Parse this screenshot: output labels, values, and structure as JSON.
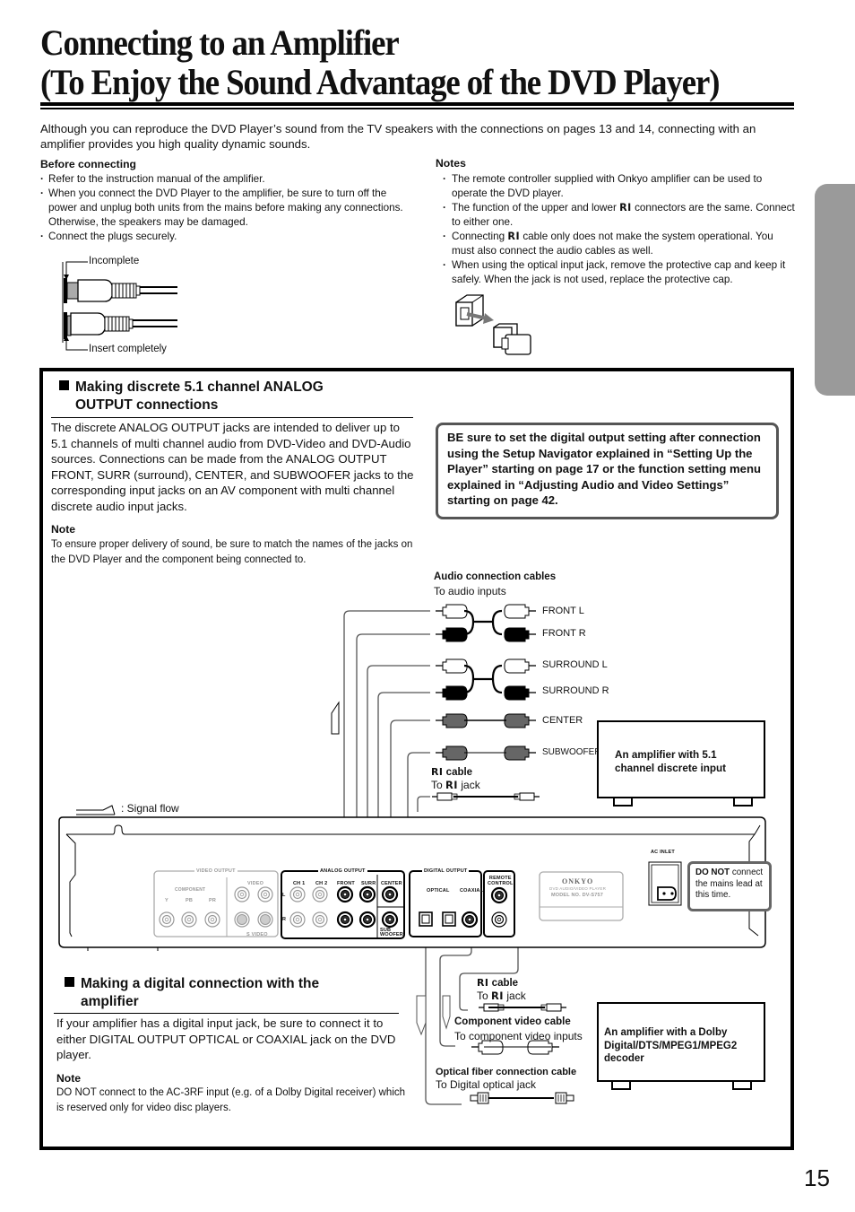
{
  "page": {
    "title_line1": "Connecting to an Amplifier",
    "title_line2": "(To Enjoy the Sound Advantage of the DVD Player)",
    "intro": "Although you can reproduce the DVD Player’s sound from the TV speakers with the connections on pages 13 and 14, connecting with an amplifier provides you high quality dynamic sounds.",
    "page_number": "15"
  },
  "before_connecting": {
    "heading": "Before connecting",
    "items": [
      "Refer to the instruction manual of the amplifier.",
      "When you connect the DVD Player to the amplifier, be sure to turn off the power and unplug both units from the mains before making any connections. Otherwise, the speakers may be damaged.",
      "Connect the plugs securely."
    ],
    "figure": {
      "label_incomplete": "Incomplete",
      "label_complete": "Insert completely"
    }
  },
  "notes": {
    "heading": "Notes",
    "ri_symbol": "RI",
    "items": [
      {
        "pre": "The remote controller supplied with Onkyo amplifier can be used to operate the DVD player.",
        "post": ""
      },
      {
        "pre": "The function of the upper and lower ",
        "post": " connectors are the same. Connect to either one."
      },
      {
        "pre": "Connecting ",
        "post": " cable only does not make the system operational. You must also connect the audio cables as well."
      },
      {
        "pre": "When using the optical input jack, remove the protective cap and keep it safely. When the jack is not used, replace the protective cap.",
        "post": ""
      }
    ]
  },
  "analog_section": {
    "heading_line1": "Making discrete 5.1 channel ANALOG",
    "heading_line2": "OUTPUT connections",
    "body": "The discrete ANALOG OUTPUT jacks are intended to deliver up to 5.1 channels of multi channel audio from DVD-Video and DVD-Audio sources. Connections can be made from the ANALOG OUTPUT FRONT, SURR (surround), CENTER, and SUBWOOFER jacks to the corresponding input jacks on an AV component with multi channel discrete audio input jacks.",
    "note_heading": "Note",
    "note_body": "To ensure proper delivery of sound, be sure to match the names of the jacks on the DVD Player and the component being connected to."
  },
  "warning_box": "BE sure to set the digital output setting after connection using the Setup Navigator explained in “Setting Up the Player” starting on page 17 or the function setting menu explained in “Adjusting Audio and Video Settings” starting on page 42.",
  "diagram": {
    "audio_cables_heading": "Audio connection cables",
    "audio_cables_sub": "To audio inputs",
    "channels": [
      "FRONT L",
      "FRONT R",
      "SURROUND L",
      "SURROUND R",
      "CENTER",
      "SUBWOOFER"
    ],
    "ri_cable_heading": "cable",
    "ri_cable_sub_pre": "To ",
    "ri_cable_sub_post": " jack",
    "amp_51": "An amplifier with 5.1 channel discrete input",
    "signal_flow": ": Signal flow",
    "component_video_heading": "Component video cable",
    "component_video_sub": "To component video inputs",
    "optical_heading": "Optical fiber connection cable",
    "optical_sub": "To Digital optical jack",
    "amp_dolby": "An amplifier with a Dolby Digital/DTS/MPEG1/MPEG2 decoder"
  },
  "rear_panel": {
    "video_output": "VIDEO OUTPUT",
    "component": "COMPONENT",
    "y": "Y",
    "pb": "PB",
    "pr": "PR",
    "video": "VIDEO",
    "s_video": "S VIDEO",
    "analog_output": "ANALOG OUTPUT",
    "ch1": "CH 1",
    "ch2": "CH 2",
    "front": "FRONT",
    "surr": "SURR",
    "center": "CENTER",
    "l": "L",
    "r": "R",
    "sub_woofer_1": "SUB",
    "sub_woofer_2": "WOOFER",
    "digital_output": "DIGITAL OUTPUT",
    "optical": "OPTICAL",
    "coaxial": "COAXIAL",
    "remote_1": "REMOTE",
    "remote_2": "CONTROL",
    "brand": "ONKYO",
    "product": "DVD AUDIO/VIDEO PLAYER",
    "model": "MODEL NO. DV-S757",
    "ac_inlet": "AC INLET",
    "dont_bold": "DO NOT",
    "dont_rest": " connect the mains lead at this time."
  },
  "digital_section": {
    "heading_line1": "Making a digital connection with the",
    "heading_line2": "amplifier",
    "body": "If your amplifier has a digital input jack, be sure to connect it to either DIGITAL OUTPUT OPTICAL or COAXIAL jack on the DVD player.",
    "note_heading": "Note",
    "note_body": "DO NOT connect to the AC-3RF input (e.g. of a Dolby Digital receiver) which is reserved only for video disc players."
  }
}
